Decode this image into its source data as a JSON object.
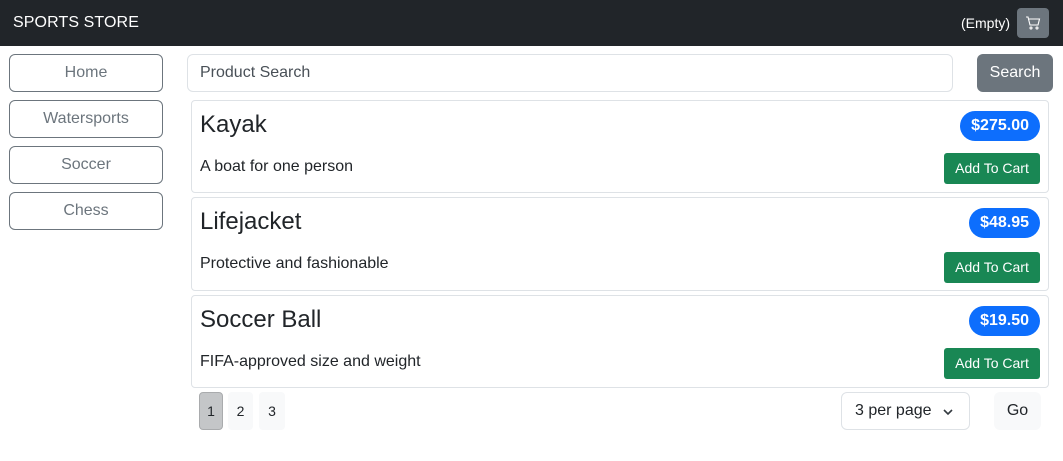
{
  "navbar": {
    "brand": "SPORTS STORE",
    "cart_status": "(Empty)",
    "cart_icon": "cart-icon"
  },
  "categories": [
    {
      "label": "Home"
    },
    {
      "label": "Watersports"
    },
    {
      "label": "Soccer"
    },
    {
      "label": "Chess"
    }
  ],
  "search": {
    "placeholder": "Product Search",
    "value": "",
    "button_label": "Search"
  },
  "products": [
    {
      "name": "Kayak",
      "price": "$275.00",
      "description": "A boat for one person",
      "add_label": "Add To Cart"
    },
    {
      "name": "Lifejacket",
      "price": "$48.95",
      "description": "Protective and fashionable",
      "add_label": "Add To Cart"
    },
    {
      "name": "Soccer Ball",
      "price": "$19.50",
      "description": "FIFA-approved size and weight",
      "add_label": "Add To Cart"
    }
  ],
  "pagination": {
    "pages": [
      "1",
      "2",
      "3"
    ],
    "current_page": "1",
    "per_page": "3 per page",
    "go_label": "Go"
  },
  "colors": {
    "navbar": "#212529",
    "secondary": "#6c757d",
    "price_badge": "#0d6efd",
    "add_button": "#198754"
  }
}
